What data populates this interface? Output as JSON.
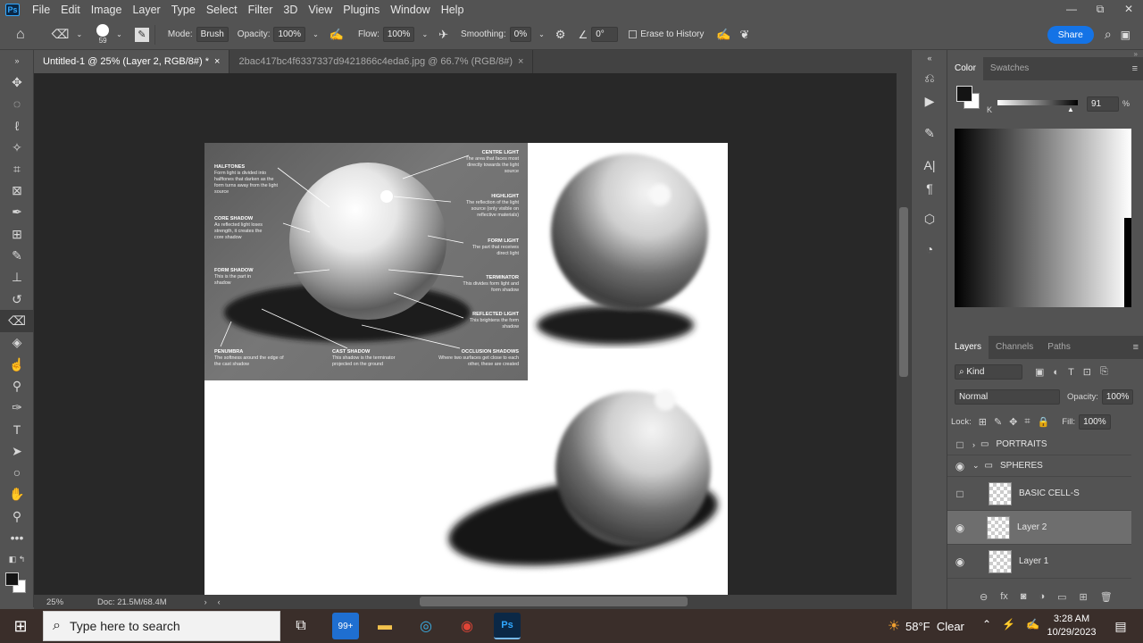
{
  "app": {
    "logo": "Ps",
    "menu": [
      "File",
      "Edit",
      "Image",
      "Layer",
      "Type",
      "Select",
      "Filter",
      "3D",
      "View",
      "Plugins",
      "Window",
      "Help"
    ]
  },
  "window_controls": [
    "—",
    "⧉",
    "✕"
  ],
  "options": {
    "brush_size": "59",
    "mode_label": "Mode:",
    "mode_value": "Brush",
    "opacity_label": "Opacity:",
    "opacity_value": "100%",
    "flow_label": "Flow:",
    "flow_value": "100%",
    "smoothing_label": "Smoothing:",
    "smoothing_value": "0%",
    "angle_value": "0°",
    "erase_history": "Erase to History",
    "share": "Share"
  },
  "tabs": [
    {
      "label": "Untitled-1 @ 25% (Layer 2, RGB/8#) *",
      "close": "×"
    },
    {
      "label": "2bac417bc4f6337337d9421866c4eda6.jpg @ 66.7% (RGB/8#)",
      "close": "×"
    }
  ],
  "reference": {
    "halftones_t": "HALFTONES",
    "halftones_d": "Form light is divided into halftones that darken as the form turns away from the light source",
    "core_t": "CORE SHADOW",
    "core_d": "As reflected light loses strength, it creates the core shadow",
    "formshadow_t": "FORM SHADOW",
    "formshadow_d": "This is the part in shadow",
    "penumbra_t": "PENUMBRA",
    "penumbra_d": "The softness around the edge of the cast shadow",
    "cast_t": "CAST SHADOW",
    "cast_d": "This shadow is the terminator projected on the ground",
    "occlusion_t": "OCCLUSION SHADOWS",
    "occlusion_d": "Where two surfaces get close to each other, these are created",
    "centre_t": "CENTRE LIGHT",
    "centre_d": "The area that faces most directly towards the light source",
    "highlight_t": "HIGHLIGHT",
    "highlight_d": "The reflection of the light source (only visible on reflective materials)",
    "formlight_t": "FORM LIGHT",
    "formlight_d": "The part that receives direct light",
    "terminator_t": "TERMINATOR",
    "terminator_d": "This divides form light and form shadow",
    "reflected_t": "REFLECTED LIGHT",
    "reflected_d": "This brightens the form shadow"
  },
  "status": {
    "zoom": "25%",
    "doc": "Doc: 21.5M/68.4M"
  },
  "color_panel": {
    "tabs": [
      "Color",
      "Swatches"
    ],
    "channel": "K",
    "value": "91",
    "unit": "%"
  },
  "layers_panel": {
    "tabs": [
      "Layers",
      "Channels",
      "Paths"
    ],
    "kind": "Kind",
    "blend": "Normal",
    "opacity_label": "Opacity:",
    "opacity_value": "100%",
    "lock_label": "Lock:",
    "fill_label": "Fill:",
    "fill_value": "100%",
    "layers": [
      {
        "name": "PORTRAITS"
      },
      {
        "name": "SPHERES"
      },
      {
        "name": "BASIC CELL-S"
      },
      {
        "name": "Layer 2"
      },
      {
        "name": "Layer 1"
      }
    ]
  },
  "taskbar": {
    "search_placeholder": "Type here to search",
    "badge": "99+",
    "ps": "Ps",
    "weather": "58°F  Clear",
    "time": "3:28 AM",
    "date": "10/29/2023"
  },
  "colors": {
    "accent": "#1473e6",
    "ui_bg": "#535353",
    "canvas_bg": "#282828"
  }
}
